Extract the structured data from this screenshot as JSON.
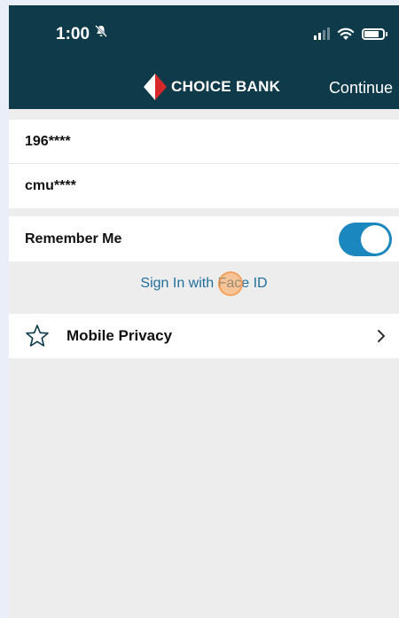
{
  "status_bar": {
    "time": "1:00",
    "bell_icon": "bell-slash-icon"
  },
  "header": {
    "brand": "CHOICE BANK",
    "continue_label": "Continue"
  },
  "login": {
    "username": "196****",
    "password": "cmu****"
  },
  "remember": {
    "label": "Remember Me",
    "enabled": true
  },
  "faceid": {
    "label": "Sign In with Face ID"
  },
  "menu": {
    "privacy_label": "Mobile Privacy",
    "privacy_icon": "star-icon"
  },
  "colors": {
    "header_bg": "#0e3a4a",
    "accent": "#1b87bf",
    "brand_red": "#d62828",
    "link": "#1f6f9a"
  }
}
